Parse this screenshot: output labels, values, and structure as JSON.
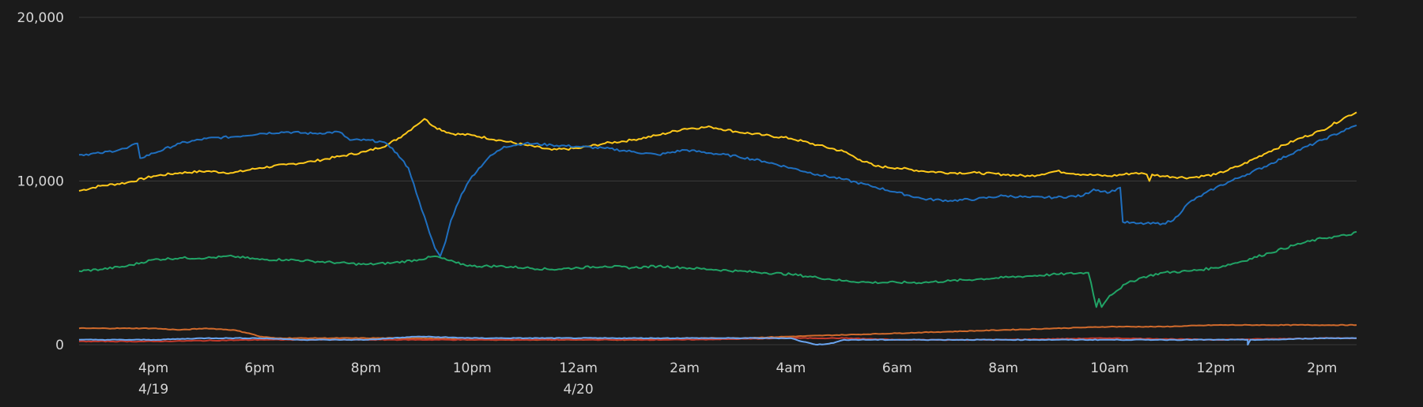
{
  "chart_data": {
    "type": "line",
    "title": "",
    "xlabel": "",
    "ylabel": "",
    "ylim": [
      0,
      20000
    ],
    "y_ticks": [
      {
        "value": 0,
        "label": "0"
      },
      {
        "value": 10000,
        "label": "10,000"
      },
      {
        "value": 20000,
        "label": "20,000"
      }
    ],
    "x_range_hours": [
      14.6,
      38.65
    ],
    "x_ticks": [
      {
        "hour": 16,
        "label": "4pm",
        "sublabel": "4/19"
      },
      {
        "hour": 18,
        "label": "6pm",
        "sublabel": ""
      },
      {
        "hour": 20,
        "label": "8pm",
        "sublabel": ""
      },
      {
        "hour": 22,
        "label": "10pm",
        "sublabel": ""
      },
      {
        "hour": 24,
        "label": "12am",
        "sublabel": "4/20"
      },
      {
        "hour": 26,
        "label": "2am",
        "sublabel": ""
      },
      {
        "hour": 28,
        "label": "4am",
        "sublabel": ""
      },
      {
        "hour": 30,
        "label": "6am",
        "sublabel": ""
      },
      {
        "hour": 32,
        "label": "8am",
        "sublabel": ""
      },
      {
        "hour": 34,
        "label": "10am",
        "sublabel": ""
      },
      {
        "hour": 36,
        "label": "12pm",
        "sublabel": ""
      },
      {
        "hour": 38,
        "label": "2pm",
        "sublabel": ""
      }
    ],
    "grid": true,
    "legend": "none",
    "colors": {
      "background": "#1b1b1b",
      "grid": "#3a3a3a",
      "tick_text": "#d6d6d6"
    },
    "series": [
      {
        "color": "#ffc91b",
        "points": [
          [
            14.6,
            9400
          ],
          [
            15,
            9700
          ],
          [
            15.5,
            9900
          ],
          [
            16,
            10300
          ],
          [
            16.5,
            10500
          ],
          [
            17,
            10600
          ],
          [
            17.5,
            10500
          ],
          [
            18,
            10800
          ],
          [
            18.5,
            11000
          ],
          [
            19,
            11200
          ],
          [
            19.5,
            11500
          ],
          [
            20,
            11800
          ],
          [
            20.4,
            12200
          ],
          [
            20.7,
            12800
          ],
          [
            20.9,
            13300
          ],
          [
            21.1,
            13800
          ],
          [
            21.3,
            13300
          ],
          [
            21.6,
            12900
          ],
          [
            22,
            12800
          ],
          [
            22.5,
            12500
          ],
          [
            23,
            12200
          ],
          [
            23.5,
            11900
          ],
          [
            24,
            12000
          ],
          [
            24.5,
            12300
          ],
          [
            25,
            12500
          ],
          [
            25.5,
            12800
          ],
          [
            26,
            13200
          ],
          [
            26.5,
            13300
          ],
          [
            27,
            13000
          ],
          [
            27.5,
            12800
          ],
          [
            28,
            12600
          ],
          [
            28.5,
            12200
          ],
          [
            29,
            11800
          ],
          [
            29.3,
            11300
          ],
          [
            29.6,
            10900
          ],
          [
            30,
            10800
          ],
          [
            30.5,
            10600
          ],
          [
            31,
            10500
          ],
          [
            31.5,
            10500
          ],
          [
            32,
            10400
          ],
          [
            32.5,
            10300
          ],
          [
            33,
            10600
          ],
          [
            33.5,
            10400
          ],
          [
            34,
            10300
          ],
          [
            34.5,
            10500
          ],
          [
            34.7,
            10400
          ],
          [
            34.75,
            10000
          ],
          [
            34.8,
            10400
          ],
          [
            35,
            10300
          ],
          [
            35.5,
            10200
          ],
          [
            36,
            10400
          ],
          [
            36.5,
            11000
          ],
          [
            37,
            11800
          ],
          [
            37.5,
            12500
          ],
          [
            38,
            13100
          ],
          [
            38.5,
            14000
          ],
          [
            38.65,
            14200
          ]
        ]
      },
      {
        "color": "#1f6fbf",
        "points": [
          [
            14.6,
            11600
          ],
          [
            15,
            11700
          ],
          [
            15.5,
            12000
          ],
          [
            15.7,
            12300
          ],
          [
            15.75,
            11400
          ],
          [
            16,
            11700
          ],
          [
            16.5,
            12300
          ],
          [
            17,
            12600
          ],
          [
            17.5,
            12700
          ],
          [
            18,
            12900
          ],
          [
            18.5,
            13000
          ],
          [
            19,
            12900
          ],
          [
            19.5,
            13000
          ],
          [
            19.7,
            12500
          ],
          [
            20,
            12500
          ],
          [
            20.3,
            12400
          ],
          [
            20.5,
            12000
          ],
          [
            20.8,
            10800
          ],
          [
            21,
            8800
          ],
          [
            21.2,
            6800
          ],
          [
            21.3,
            5900
          ],
          [
            21.4,
            5400
          ],
          [
            21.5,
            6300
          ],
          [
            21.6,
            7600
          ],
          [
            21.8,
            9200
          ],
          [
            22,
            10300
          ],
          [
            22.3,
            11400
          ],
          [
            22.6,
            12100
          ],
          [
            23,
            12300
          ],
          [
            23.5,
            12200
          ],
          [
            24,
            12100
          ],
          [
            24.5,
            12000
          ],
          [
            25,
            11800
          ],
          [
            25.5,
            11600
          ],
          [
            26,
            11900
          ],
          [
            26.5,
            11700
          ],
          [
            27,
            11500
          ],
          [
            27.5,
            11200
          ],
          [
            28,
            10800
          ],
          [
            28.5,
            10400
          ],
          [
            29,
            10100
          ],
          [
            29.5,
            9700
          ],
          [
            30,
            9300
          ],
          [
            30.5,
            8900
          ],
          [
            31,
            8800
          ],
          [
            31.5,
            8900
          ],
          [
            32,
            9100
          ],
          [
            32.5,
            9000
          ],
          [
            33,
            9000
          ],
          [
            33.5,
            9100
          ],
          [
            33.7,
            9500
          ],
          [
            34,
            9300
          ],
          [
            34.2,
            9600
          ],
          [
            34.25,
            7500
          ],
          [
            34.5,
            7400
          ],
          [
            35,
            7400
          ],
          [
            35.2,
            7600
          ],
          [
            35.5,
            8700
          ],
          [
            36,
            9600
          ],
          [
            36.5,
            10300
          ],
          [
            37,
            11000
          ],
          [
            37.5,
            11800
          ],
          [
            38,
            12500
          ],
          [
            38.5,
            13200
          ],
          [
            38.65,
            13400
          ]
        ]
      },
      {
        "color": "#21a366",
        "points": [
          [
            14.6,
            4500
          ],
          [
            15,
            4600
          ],
          [
            15.5,
            4800
          ],
          [
            16,
            5200
          ],
          [
            16.5,
            5300
          ],
          [
            17,
            5300
          ],
          [
            17.5,
            5400
          ],
          [
            18,
            5200
          ],
          [
            18.5,
            5200
          ],
          [
            19,
            5100
          ],
          [
            19.5,
            5000
          ],
          [
            20,
            4900
          ],
          [
            20.5,
            5000
          ],
          [
            21,
            5200
          ],
          [
            21.3,
            5400
          ],
          [
            21.7,
            5000
          ],
          [
            22,
            4800
          ],
          [
            22.5,
            4800
          ],
          [
            23,
            4700
          ],
          [
            23.5,
            4600
          ],
          [
            24,
            4700
          ],
          [
            24.5,
            4800
          ],
          [
            25,
            4700
          ],
          [
            25.5,
            4800
          ],
          [
            26,
            4700
          ],
          [
            26.5,
            4600
          ],
          [
            27,
            4500
          ],
          [
            27.5,
            4400
          ],
          [
            28,
            4300
          ],
          [
            28.5,
            4100
          ],
          [
            29,
            3900
          ],
          [
            29.5,
            3800
          ],
          [
            30,
            3800
          ],
          [
            30.5,
            3800
          ],
          [
            31,
            3900
          ],
          [
            31.5,
            4000
          ],
          [
            32,
            4100
          ],
          [
            32.5,
            4200
          ],
          [
            33,
            4300
          ],
          [
            33.6,
            4400
          ],
          [
            33.65,
            3800
          ],
          [
            33.75,
            2300
          ],
          [
            33.8,
            2800
          ],
          [
            33.85,
            2300
          ],
          [
            34,
            3000
          ],
          [
            34.3,
            3700
          ],
          [
            34.6,
            4100
          ],
          [
            35,
            4400
          ],
          [
            35.5,
            4500
          ],
          [
            36,
            4700
          ],
          [
            36.5,
            5100
          ],
          [
            37,
            5600
          ],
          [
            37.5,
            6100
          ],
          [
            38,
            6500
          ],
          [
            38.5,
            6700
          ],
          [
            38.65,
            6900
          ]
        ]
      },
      {
        "color": "#d06a2c",
        "points": [
          [
            14.6,
            1000
          ],
          [
            15,
            1000
          ],
          [
            15.5,
            1000
          ],
          [
            16,
            1000
          ],
          [
            16.5,
            900
          ],
          [
            17,
            1000
          ],
          [
            17.5,
            900
          ],
          [
            17.8,
            700
          ],
          [
            18,
            500
          ],
          [
            18.3,
            400
          ],
          [
            19,
            400
          ],
          [
            20,
            400
          ],
          [
            21,
            400
          ],
          [
            22,
            300
          ],
          [
            23,
            300
          ],
          [
            24,
            300
          ],
          [
            25,
            300
          ],
          [
            26,
            400
          ],
          [
            27,
            400
          ],
          [
            28,
            500
          ],
          [
            29,
            600
          ],
          [
            30,
            700
          ],
          [
            31,
            800
          ],
          [
            32,
            900
          ],
          [
            33,
            1000
          ],
          [
            34,
            1100
          ],
          [
            35,
            1100
          ],
          [
            36,
            1200
          ],
          [
            37,
            1200
          ],
          [
            38,
            1200
          ],
          [
            38.65,
            1200
          ]
        ]
      },
      {
        "color": "#c33a2c",
        "points": [
          [
            14.6,
            200
          ],
          [
            16,
            200
          ],
          [
            18,
            300
          ],
          [
            20,
            300
          ],
          [
            22,
            300
          ],
          [
            24,
            300
          ],
          [
            26,
            300
          ],
          [
            28,
            400
          ],
          [
            29,
            400
          ],
          [
            30,
            300
          ],
          [
            32,
            300
          ],
          [
            34,
            400
          ],
          [
            36,
            300
          ],
          [
            38,
            400
          ],
          [
            38.65,
            400
          ]
        ]
      },
      {
        "color": "#6aa5f0",
        "points": [
          [
            14.6,
            300
          ],
          [
            15,
            300
          ],
          [
            16,
            300
          ],
          [
            17,
            400
          ],
          [
            18,
            400
          ],
          [
            18.8,
            300
          ],
          [
            19,
            300
          ],
          [
            20,
            300
          ],
          [
            21,
            500
          ],
          [
            22,
            400
          ],
          [
            23,
            400
          ],
          [
            24,
            400
          ],
          [
            25,
            400
          ],
          [
            26,
            400
          ],
          [
            27,
            400
          ],
          [
            28,
            400
          ],
          [
            28.2,
            200
          ],
          [
            28.5,
            0
          ],
          [
            28.8,
            100
          ],
          [
            29,
            300
          ],
          [
            30,
            300
          ],
          [
            31,
            300
          ],
          [
            32,
            300
          ],
          [
            33,
            300
          ],
          [
            34,
            300
          ],
          [
            35,
            300
          ],
          [
            36,
            300
          ],
          [
            36.6,
            300
          ],
          [
            36.6,
            0
          ],
          [
            36.65,
            300
          ],
          [
            37,
            300
          ],
          [
            38,
            400
          ],
          [
            38.65,
            400
          ]
        ]
      }
    ]
  }
}
